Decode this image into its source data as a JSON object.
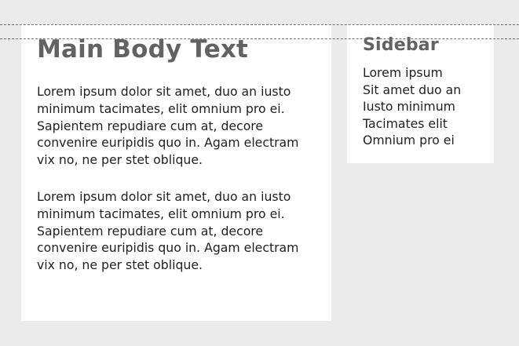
{
  "main": {
    "title": "Main Body Text",
    "paragraphs": [
      "Lorem ipsum dolor sit amet, duo an iusto minimum tacimates, elit omnium pro ei. Sapientem repudiare cum at, decore convenire euripidis quo in. Agam electram vix no, ne per stet oblique.",
      "Lorem ipsum dolor sit amet, duo an iusto minimum tacimates, elit omnium pro ei. Sapientem repudiare cum at, decore convenire euripidis quo in. Agam electram vix no, ne per stet oblique."
    ]
  },
  "sidebar": {
    "title": "Sidebar",
    "lines": [
      "Lorem ipsum",
      "Sit amet duo an",
      "Iusto minimum",
      "Tacimates elit",
      "Omnium pro ei"
    ]
  },
  "colors": {
    "page_background": "#ebebeb",
    "card_background": "#ffffff",
    "heading_text": "#626262",
    "body_text": "#1f1f1f",
    "guide_line": "#d9434a"
  }
}
